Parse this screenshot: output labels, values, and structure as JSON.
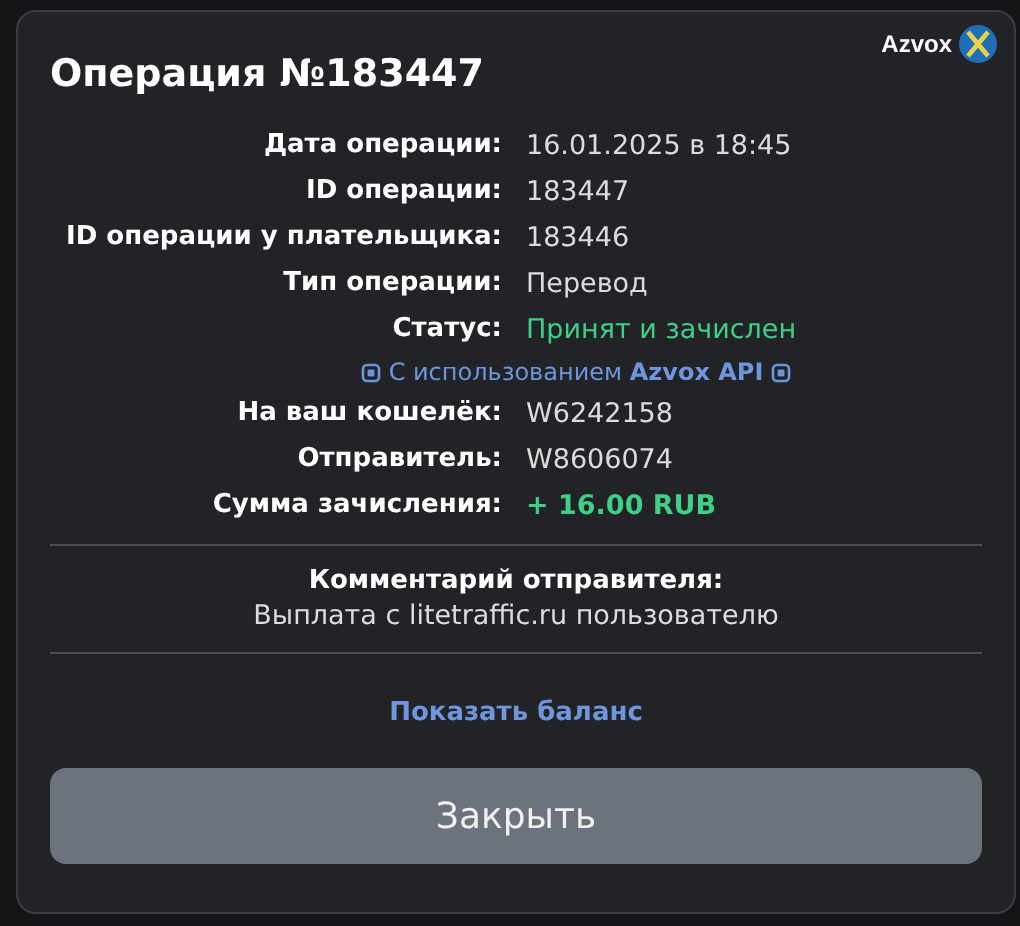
{
  "dialog": {
    "title": "Операция №183447",
    "brand": "Azvox"
  },
  "rows": [
    {
      "kind": "field",
      "label": "Дата операции:",
      "value": "16.01.2025 в 18:45"
    },
    {
      "kind": "field",
      "label": "ID операции:",
      "value": "183447"
    },
    {
      "kind": "field",
      "label": "ID операции у плательщика:",
      "value": "183446"
    },
    {
      "kind": "field",
      "label": "Тип операции:",
      "value": "Перевод"
    },
    {
      "kind": "status",
      "label": "Статус:",
      "value": "Принят и зачислен"
    },
    {
      "kind": "note",
      "value": "С использованием **Azvox API**"
    },
    {
      "kind": "field",
      "label": "На ваш кошелёк:",
      "value": "W6242158"
    },
    {
      "kind": "field",
      "label": "Отправитель:",
      "value": "W8606074"
    },
    {
      "kind": "amount",
      "label": "Сумма зачисления:",
      "value": "+ 16.00 RUB"
    }
  ],
  "comment": {
    "heading": "Комментарий отправителя:",
    "text": "Выплата с litetraffic.ru пользователю"
  },
  "link": "Показать баланс",
  "button": "Закрыть"
}
